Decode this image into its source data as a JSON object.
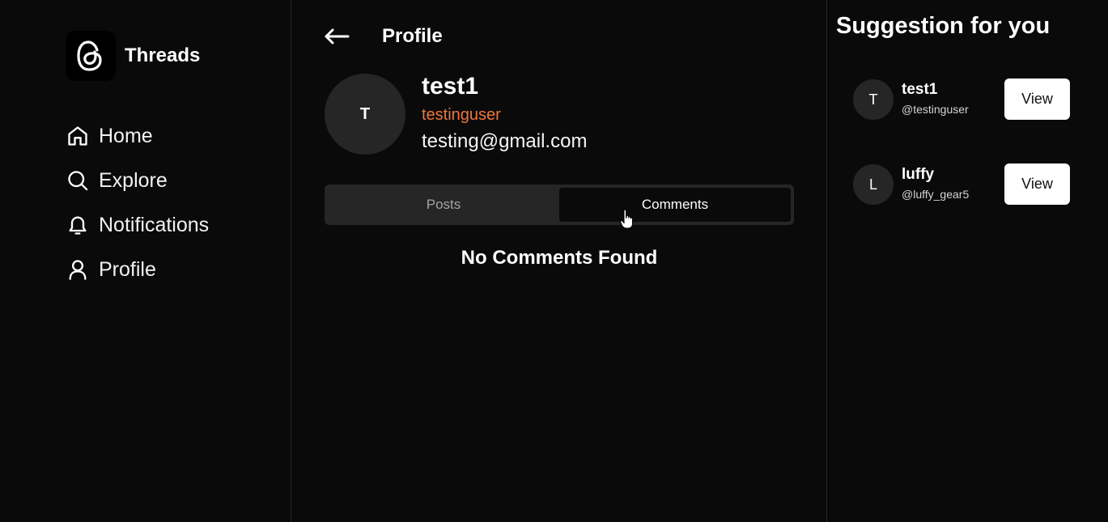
{
  "brand": {
    "name": "Threads"
  },
  "nav": {
    "items": [
      {
        "label": "Home",
        "icon": "home-icon"
      },
      {
        "label": "Explore",
        "icon": "search-icon"
      },
      {
        "label": "Notifications",
        "icon": "bell-icon"
      },
      {
        "label": "Profile",
        "icon": "user-icon"
      }
    ]
  },
  "header": {
    "title": "Profile",
    "back_icon": "arrow-left-icon"
  },
  "profile": {
    "initial": "T",
    "name": "test1",
    "username": "testinguser",
    "email": "testing@gmail.com"
  },
  "tabs": [
    {
      "label": "Posts",
      "active": false
    },
    {
      "label": "Comments",
      "active": true
    }
  ],
  "empty_message": "No Comments Found",
  "suggestions": {
    "title": "Suggestion for you",
    "items": [
      {
        "initial": "T",
        "name": "test1",
        "handle": "@testinguser",
        "button": "View"
      },
      {
        "initial": "L",
        "name": "luffy",
        "handle": "@luffy_gear5",
        "button": "View"
      }
    ]
  },
  "colors": {
    "background": "#0a0a0a",
    "accent": "#f0763c",
    "tab_bg": "#262626",
    "button_bg": "#ffffff"
  }
}
